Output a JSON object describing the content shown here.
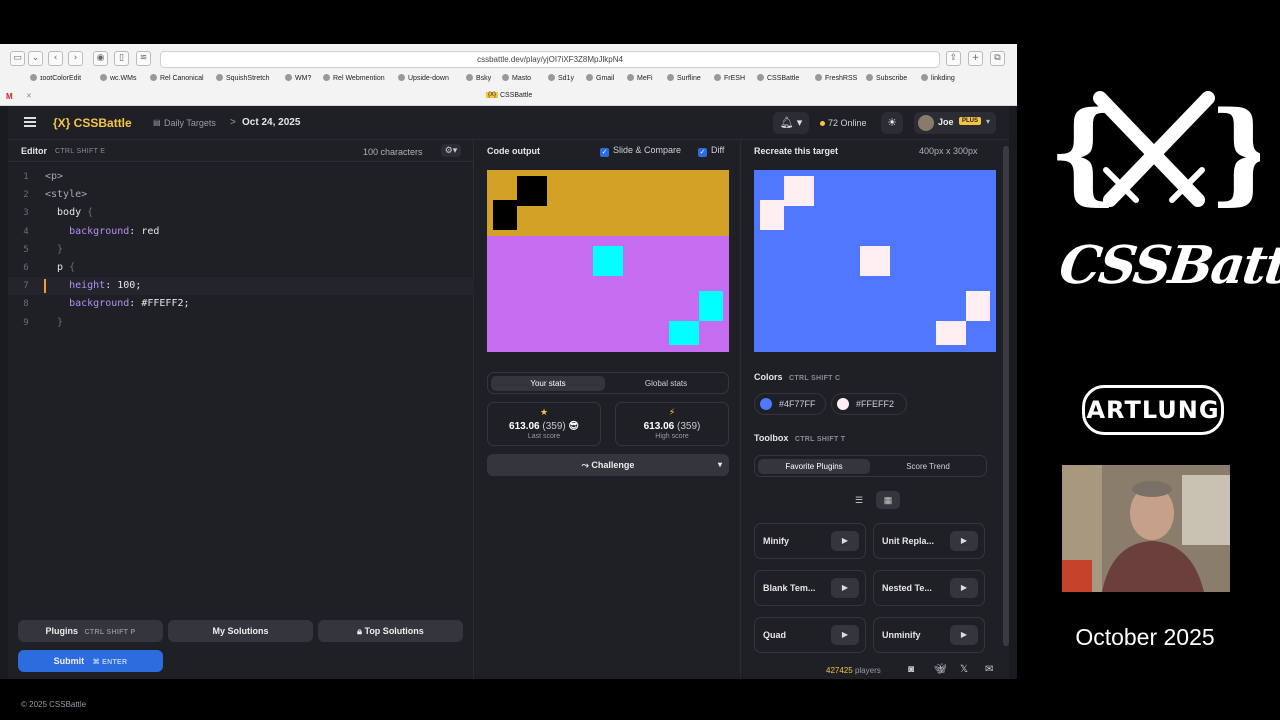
{
  "browser": {
    "url": "cssbattle.dev/play/yjOI7iXF3Z8MpJlkpN4",
    "tab_title": "CSSBattle",
    "bookmarks": [
      "ɪootColorEdit",
      "wc.WMs",
      "Rel Canonical",
      "SquishStretch",
      "WM?",
      "Rel Webmention",
      "Upside-down",
      "Bsky",
      "Masto",
      "Sd1y",
      "Gmail",
      "MeFi",
      "Surfline",
      "FrESH",
      "CSSBattle",
      "FreshRSS",
      "Subscribe",
      "linkding"
    ]
  },
  "header": {
    "logo": "{X} CSSBattle",
    "breadcrumb_daily": "Daily Targets",
    "breadcrumb_sep": ">",
    "breadcrumb_date": "Oct 24, 2025",
    "online": "72 Online",
    "user_name": "Joe",
    "plus_badge": "PLUS"
  },
  "editor": {
    "title": "Editor",
    "shortcut": "CTRL  SHIFT  E",
    "char_count": "100 characters",
    "lines": [
      {
        "n": "1",
        "parts": [
          {
            "t": "<p>",
            "c": "c-tag"
          }
        ]
      },
      {
        "n": "2",
        "parts": [
          {
            "t": "<style>",
            "c": "c-tag"
          }
        ]
      },
      {
        "n": "3",
        "parts": [
          {
            "t": "  body ",
            "c": "c-sel"
          },
          {
            "t": "{",
            "c": "c-brace"
          }
        ]
      },
      {
        "n": "4",
        "parts": [
          {
            "t": "    background",
            "c": "c-prop"
          },
          {
            "t": ": red",
            "c": "c-val"
          }
        ]
      },
      {
        "n": "5",
        "parts": [
          {
            "t": "  }",
            "c": "c-brace"
          }
        ]
      },
      {
        "n": "6",
        "parts": [
          {
            "t": "  p ",
            "c": "c-sel"
          },
          {
            "t": "{",
            "c": "c-brace"
          }
        ]
      },
      {
        "n": "7",
        "parts": [
          {
            "t": "    height",
            "c": "c-prop"
          },
          {
            "t": ": 100;",
            "c": "c-val"
          }
        ]
      },
      {
        "n": "8",
        "parts": [
          {
            "t": "    background",
            "c": "c-prop"
          },
          {
            "t": ": #FFEFF2;",
            "c": "c-val"
          }
        ]
      },
      {
        "n": "9",
        "parts": [
          {
            "t": "  }",
            "c": "c-brace"
          }
        ]
      }
    ],
    "active_line": 7
  },
  "buttons": {
    "plugins": "Plugins",
    "plugins_kbd": "CTRL  SHIFT  P",
    "my_solutions": "My Solutions",
    "top_solutions": "Top Solutions",
    "submit": "Submit",
    "submit_kbd": "⌘  ENTER"
  },
  "output": {
    "title": "Code output",
    "slide_compare": "Slide & Compare",
    "diff": "Diff",
    "tab_your_stats": "Your stats",
    "tab_global_stats": "Global stats",
    "last_score": "613.06",
    "last_chars": "(359)",
    "last_label": "Last score",
    "high_score": "613.06",
    "high_chars": "(359)",
    "high_label": "High score",
    "challenge": "Challenge"
  },
  "target": {
    "title": "Recreate this target",
    "size": "400px x 300px",
    "colors_title": "Colors",
    "colors_kbd": "CTRL  SHIFT  C",
    "colors": [
      {
        "hex": "#4F77FF",
        "label": "#4F77FF"
      },
      {
        "hex": "#FFEFF2",
        "label": "#FFEFF2"
      }
    ],
    "toolbox_title": "Toolbox",
    "toolbox_kbd": "CTRL  SHIFT  T",
    "tab_favorite": "Favorite Plugins",
    "tab_trend": "Score Trend",
    "plugins": [
      "Minify",
      "Unit Repla...",
      "Blank Tem...",
      "Nested Te...",
      "Quad",
      "Unminify"
    ]
  },
  "footer": {
    "copyright": "© 2025 CSSBattle",
    "players_count": "427425",
    "players_label": "players"
  },
  "side": {
    "brand": "CSSBattle",
    "artlung": "ARTLUNG",
    "month": "October 2025"
  },
  "colors": {
    "accent": "#f5c542",
    "output_bg": "#c66cf0",
    "output_top": "#d4a127",
    "cyan": "#00ffff",
    "target_bg": "#4f77ff",
    "target_fg": "#ffeff2"
  }
}
